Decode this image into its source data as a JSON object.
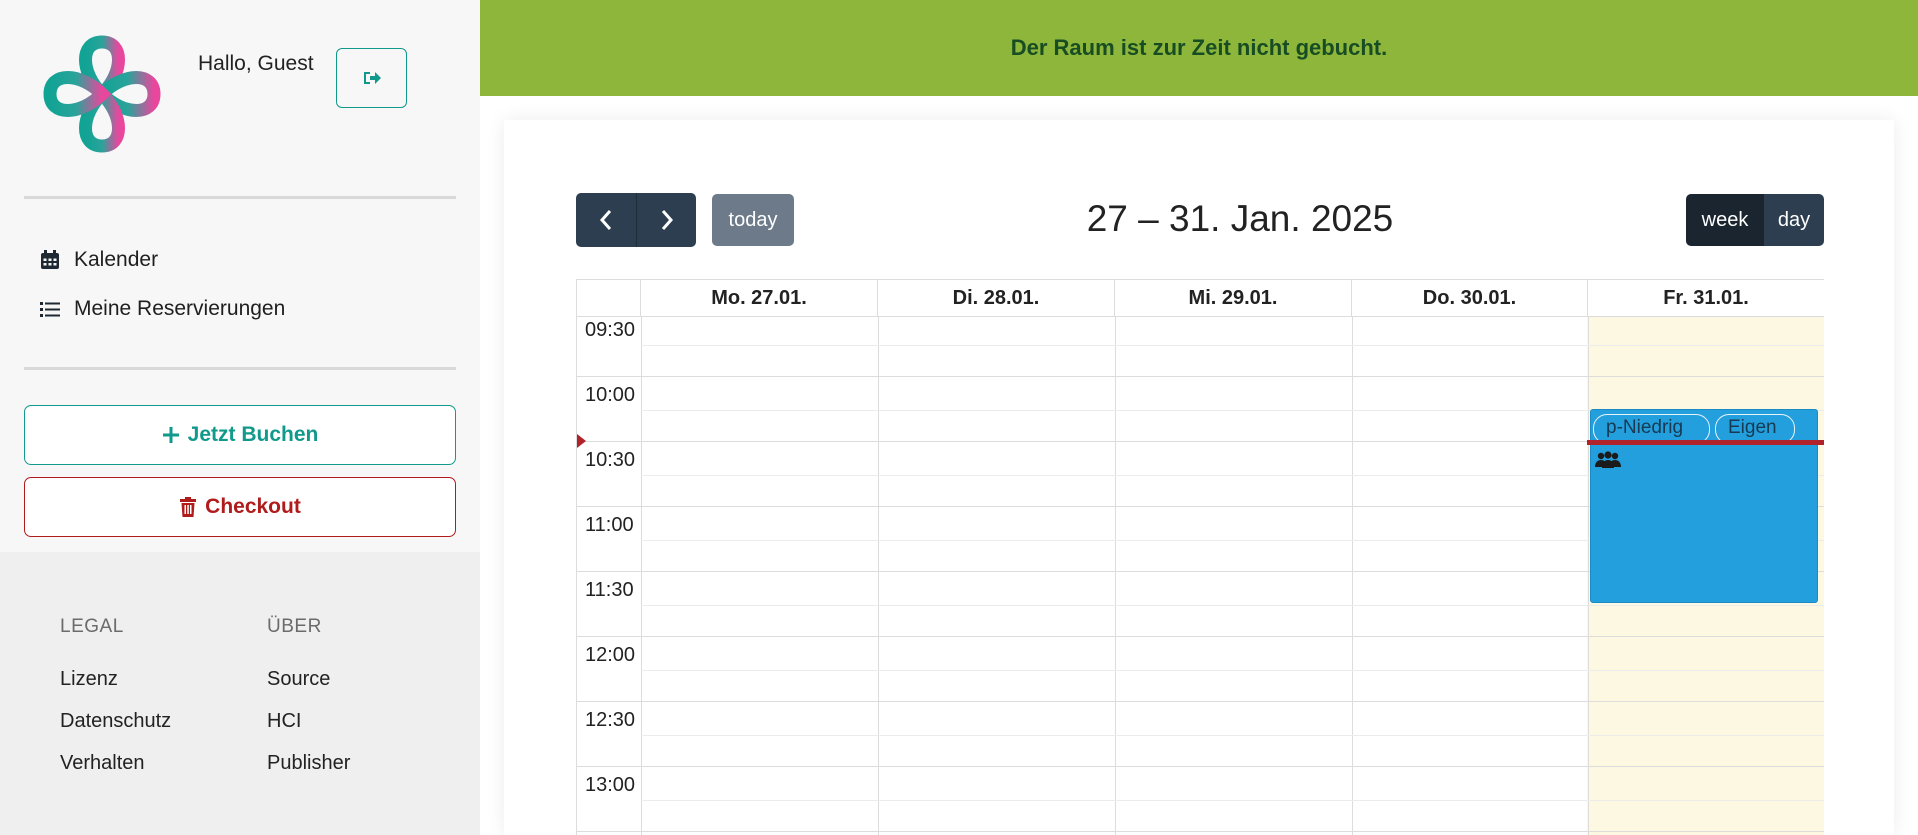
{
  "header": {
    "greeting": "Hallo, Guest",
    "banner": "Der Raum ist zur Zeit nicht gebucht."
  },
  "nav": {
    "items": [
      {
        "label": "Kalender",
        "icon": "calendar-icon"
      },
      {
        "label": "Meine Reservierungen",
        "icon": "list-icon"
      }
    ]
  },
  "actions": {
    "book_label": "Jetzt Buchen",
    "checkout_label": "Checkout"
  },
  "footer": {
    "legal_heading": "LEGAL",
    "legal_links": [
      "Lizenz",
      "Datenschutz",
      "Verhalten"
    ],
    "about_heading": "ÜBER",
    "about_links": [
      "Source",
      "HCI",
      "Publisher"
    ]
  },
  "calendar": {
    "title": "27 – 31. Jan. 2025",
    "today_label": "today",
    "view_week": "week",
    "view_day": "day",
    "days": [
      "Mo. 27.01.",
      "Di. 28.01.",
      "Mi. 29.01.",
      "Do. 30.01.",
      "Fr. 31.01."
    ],
    "times": [
      "09:30",
      "10:00",
      "10:30",
      "11:00",
      "11:30",
      "12:00",
      "12:30",
      "13:00"
    ],
    "event": {
      "tags": [
        "p-Niedrig",
        "Eigen"
      ]
    }
  },
  "colors": {
    "accent": "#119a8c",
    "danger": "#b01c1c",
    "banner": "#8db63b",
    "event": "#239fde",
    "now_indicator": "#b0232a",
    "nav_dark": "#2c3e50"
  }
}
